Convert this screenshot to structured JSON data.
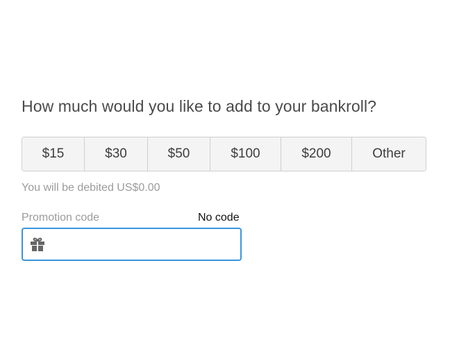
{
  "question": "How much would you like to add to your bankroll?",
  "amounts": [
    {
      "label": "$15"
    },
    {
      "label": "$30"
    },
    {
      "label": "$50"
    },
    {
      "label": "$100"
    },
    {
      "label": "$200"
    },
    {
      "label": "Other"
    }
  ],
  "debit_note": "You will be debited US$0.00",
  "promo": {
    "label": "Promotion code",
    "no_code_label": "No code",
    "value": "",
    "icon": "gift-icon"
  },
  "colors": {
    "focus_border": "#3a95dc",
    "button_bg": "#f4f4f4",
    "muted_text": "#9b9b9b"
  }
}
